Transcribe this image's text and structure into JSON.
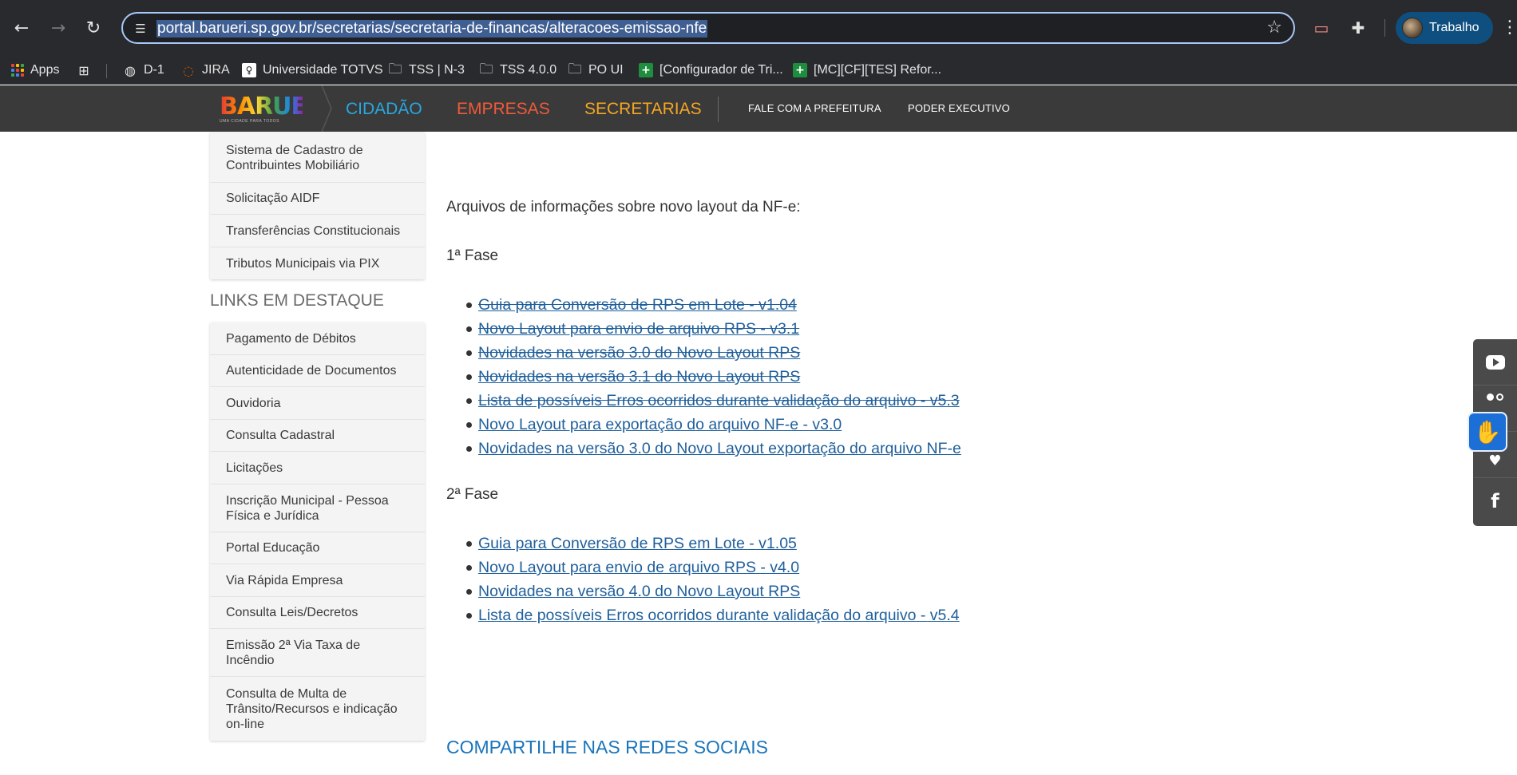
{
  "browser": {
    "url": "portal.barueri.sp.gov.br/secretarias/secretaria-de-financas/alteracoes-emissao-nfe",
    "profile_label": "Trabalho",
    "bookmarks": [
      {
        "label": "Apps"
      },
      {
        "label": ""
      },
      {
        "label": "D-1"
      },
      {
        "label": "JIRA"
      },
      {
        "label": "Universidade TOTVS"
      },
      {
        "label": "TSS | N-3"
      },
      {
        "label": "TSS 4.0.0"
      },
      {
        "label": "PO UI"
      },
      {
        "label": "[Configurador de Tri..."
      },
      {
        "label": "[MC][CF][TES] Refor..."
      }
    ]
  },
  "header": {
    "logo_text": "BARUERI",
    "logo_tag": "UMA CIDADE PARA TODOS",
    "menu": [
      "CIDADÃO",
      "EMPRESAS",
      "SECRETARIAS"
    ],
    "submenu": [
      "FALE COM A PREFEITURA",
      "PODER EXECUTIVO"
    ],
    "colors": {
      "cidadao": "#29a7df",
      "empresas": "#f05a3a",
      "secretarias": "#f5a623"
    }
  },
  "sidebar": {
    "top_items": [
      "Sistema de Cadastro de Contribuintes Mobiliário",
      "Solicitação AIDF",
      "Transferências Constitucionais",
      "Tributos Municipais via PIX"
    ],
    "links_title": "LINKS EM DESTAQUE",
    "links": [
      "Pagamento de Débitos",
      "Autenticidade de Documentos",
      "Ouvidoria",
      "Consulta Cadastral",
      "Licitações",
      "Inscrição Municipal - Pessoa Física e Jurídica",
      "Portal Educação",
      "Via Rápida Empresa",
      "Consulta Leis/Decretos",
      "Emissão 2ª Via Taxa de Incêndio",
      "Consulta de Multa de Trânsito/Recursos e indicação on-line"
    ]
  },
  "content": {
    "heading": "Arquivos de informações sobre novo layout da NF-e:",
    "phase1_title": "1ª Fase",
    "phase1_links": [
      {
        "text": "Guia para Conversão de RPS em Lote - v1.04",
        "struck": true
      },
      {
        "text": "Novo Layout para envio de arquivo RPS - v3.1",
        "struck": true
      },
      {
        "text": "Novidades na versão 3.0 do Novo Layout RPS",
        "struck": true
      },
      {
        "text": "Novidades na versão 3.1 do Novo Layout RPS",
        "struck": true
      },
      {
        "text": "Lista de possíveis Erros ocorridos durante validação do arquivo - v5.3",
        "struck": true
      },
      {
        "text": "Novo Layout para exportação do arquivo NF-e - v3.0",
        "struck": false
      },
      {
        "text": "Novidades na versão 3.0 do Novo Layout exportação do arquivo NF-e",
        "struck": false
      }
    ],
    "phase2_title": "2ª Fase",
    "phase2_links": [
      {
        "text": "Guia para Conversão de RPS em Lote - v1.05",
        "struck": false
      },
      {
        "text": "Novo Layout para envio de arquivo RPS - v4.0",
        "struck": false
      },
      {
        "text": "Novidades na versão 4.0 do Novo Layout RPS",
        "struck": false
      },
      {
        "text": "Lista de possíveis Erros ocorridos durante validação do arquivo - v5.4",
        "struck": false
      }
    ],
    "share_title": "COMPARTILHE NAS REDES SOCIAIS",
    "link_color": "#1f5f9b"
  },
  "social": [
    "youtube-icon",
    "flickr-icon",
    "twitter-icon",
    "facebook-icon"
  ],
  "accessibility": {
    "icon": "vlibras-hands-icon"
  }
}
